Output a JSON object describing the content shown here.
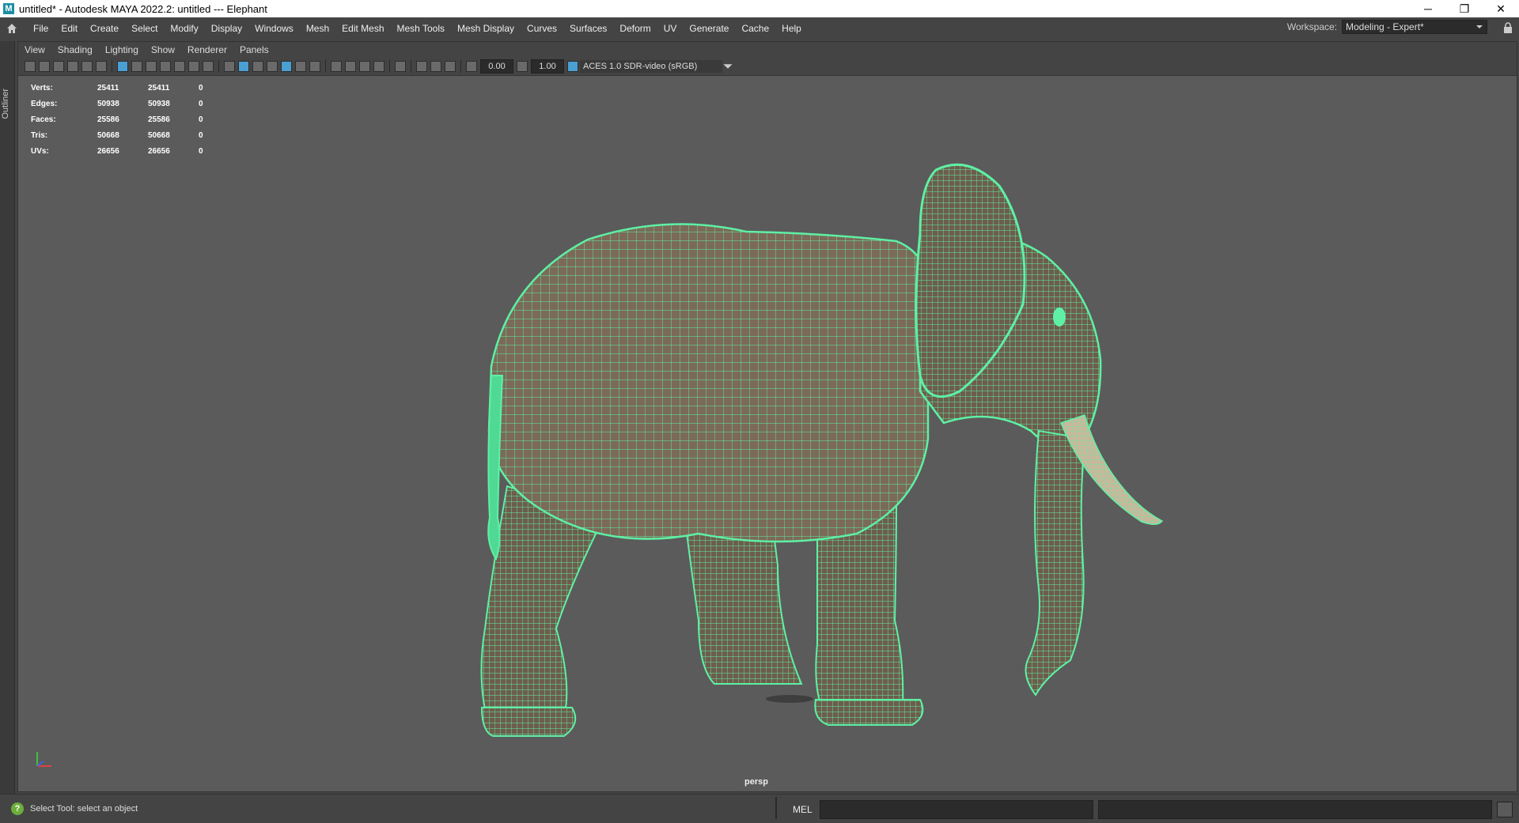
{
  "window": {
    "title": "untitled* - Autodesk MAYA 2022.2: untitled   ---   Elephant",
    "logo_letter": "M",
    "minimize": "─",
    "restore": "❐",
    "close": "✕"
  },
  "menubar": {
    "items": [
      "File",
      "Edit",
      "Create",
      "Select",
      "Modify",
      "Display",
      "Windows",
      "Mesh",
      "Edit Mesh",
      "Mesh Tools",
      "Mesh Display",
      "Curves",
      "Surfaces",
      "Deform",
      "UV",
      "Generate",
      "Cache",
      "Help"
    ],
    "workspace_label": "Workspace:",
    "workspace_value": "Modeling - Expert*"
  },
  "outliner": {
    "label": "Outliner"
  },
  "panel": {
    "menu": [
      "View",
      "Shading",
      "Lighting",
      "Show",
      "Renderer",
      "Panels"
    ],
    "toolbar": {
      "exposure": "0.00",
      "gamma": "1.00",
      "colorspace": "ACES 1.0 SDR-video (sRGB)"
    }
  },
  "hud": {
    "rows": [
      {
        "label": "Verts:",
        "a": "25411",
        "b": "25411",
        "c": "0"
      },
      {
        "label": "Edges:",
        "a": "50938",
        "b": "50938",
        "c": "0"
      },
      {
        "label": "Faces:",
        "a": "25586",
        "b": "25586",
        "c": "0"
      },
      {
        "label": "Tris:",
        "a": "50668",
        "b": "50668",
        "c": "0"
      },
      {
        "label": "UVs:",
        "a": "26656",
        "b": "26656",
        "c": "0"
      }
    ]
  },
  "viewport": {
    "camera": "persp",
    "wire_color": "#5ef0a4",
    "skin_color": "#7b6a58"
  },
  "status": {
    "help_glyph": "?",
    "message": "Select Tool: select an object",
    "mel_label": "MEL"
  }
}
